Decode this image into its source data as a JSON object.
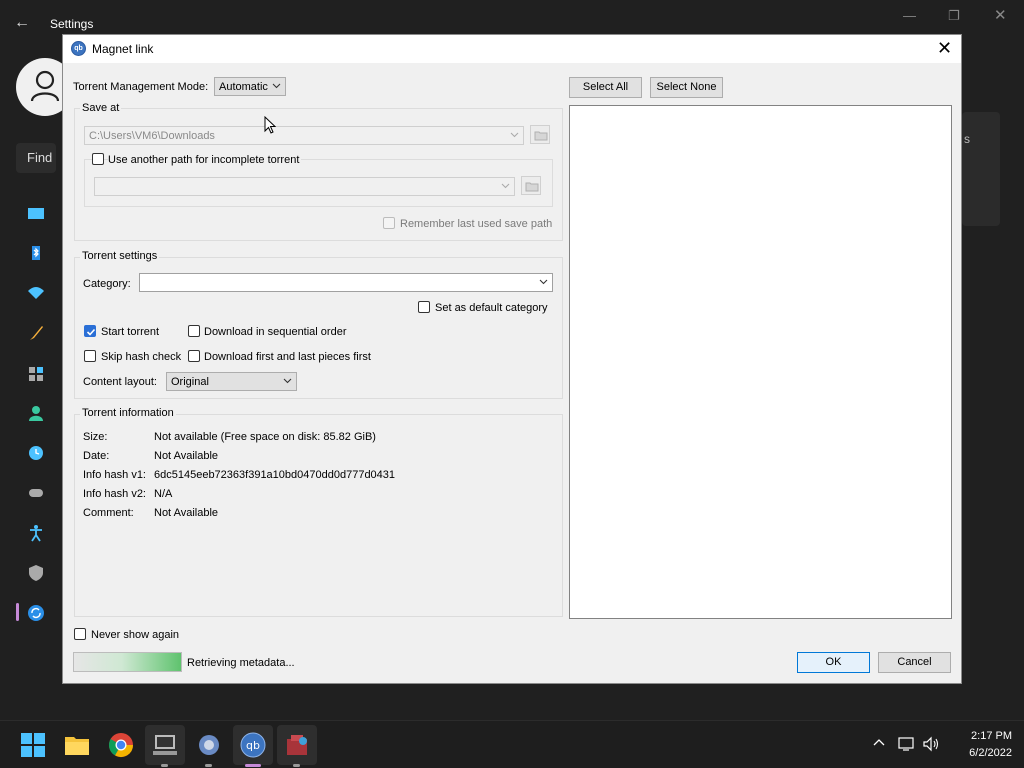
{
  "background_window": {
    "title": "Settings",
    "find_label": "Find",
    "right_card_fragment": "s"
  },
  "dialog": {
    "title": "Magnet link",
    "app_icon_text": "qb",
    "torrent_management_mode_label": "Torrent Management Mode:",
    "torrent_management_mode_value": "Automatic",
    "save_at": {
      "group_title": "Save at",
      "path_value": "C:\\Users\\VM6\\Downloads",
      "use_another_path_label": "Use another path for incomplete torrent",
      "incomplete_path_value": "",
      "remember_label": "Remember last used save path"
    },
    "torrent_settings": {
      "group_title": "Torrent settings",
      "category_label": "Category:",
      "category_value": "",
      "set_default_category_label": "Set as default category",
      "start_torrent_label": "Start torrent",
      "sequential_label": "Download in sequential order",
      "skip_hash_label": "Skip hash check",
      "first_last_label": "Download first and last pieces first",
      "content_layout_label": "Content layout:",
      "content_layout_value": "Original"
    },
    "torrent_information": {
      "group_title": "Torrent information",
      "rows": [
        {
          "label": "Size:",
          "value": "Not available (Free space on disk: 85.82 GiB)"
        },
        {
          "label": "Date:",
          "value": "Not Available"
        },
        {
          "label": "Info hash v1:",
          "value": "6dc5145eeb72363f391a10bd0470dd0d777d0431"
        },
        {
          "label": "Info hash v2:",
          "value": "N/A"
        },
        {
          "label": "Comment:",
          "value": "Not Available"
        }
      ]
    },
    "select_all_label": "Select All",
    "select_none_label": "Select None",
    "never_show_label": "Never show again",
    "progress_text": "Retrieving metadata...",
    "ok_label": "OK",
    "cancel_label": "Cancel"
  },
  "taskbar": {
    "time": "2:17 PM",
    "date": "6/2/2022"
  },
  "colors": {
    "accent": "#2a6fd6",
    "progress_green": "#5fc36e",
    "primary_button_border": "#0078d7"
  }
}
